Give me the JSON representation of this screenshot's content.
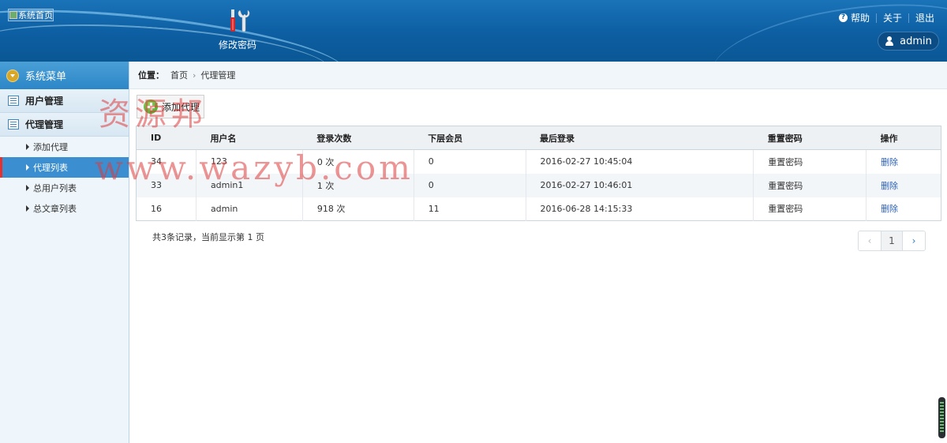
{
  "header": {
    "logo_alt": "系统首页",
    "tool_label": "修改密码",
    "links": {
      "help": "帮助",
      "about": "关于",
      "logout": "退出"
    },
    "user": "admin"
  },
  "sidebar": {
    "title": "系统菜单",
    "groups": [
      {
        "label": "用户管理"
      },
      {
        "label": "代理管理"
      }
    ],
    "items": [
      {
        "label": "添加代理"
      },
      {
        "label": "代理列表"
      },
      {
        "label": "总用户列表"
      },
      {
        "label": "总文章列表"
      }
    ]
  },
  "breadcrumb": {
    "label": "位置：",
    "home": "首页",
    "current": "代理管理"
  },
  "toolbar": {
    "add_label": "添加代理"
  },
  "table": {
    "columns": [
      "ID",
      "用户名",
      "登录次数",
      "下层会员",
      "最后登录",
      "重置密码",
      "操作"
    ],
    "rows": [
      {
        "id": "34",
        "username": "123",
        "logins": "0 次",
        "members": "0",
        "last_login": "2016-02-27 10:45:04",
        "reset": "重置密码",
        "action": "删除"
      },
      {
        "id": "33",
        "username": "admin1",
        "logins": "1 次",
        "members": "0",
        "last_login": "2016-02-27 10:46:01",
        "reset": "重置密码",
        "action": "删除"
      },
      {
        "id": "16",
        "username": "admin",
        "logins": "918 次",
        "members": "11",
        "last_login": "2016-06-28 14:15:33",
        "reset": "重置密码",
        "action": "删除"
      }
    ]
  },
  "footer": {
    "summary": "共3条记录，当前显示第 1 页"
  },
  "pager": {
    "prev": "‹",
    "current": "1",
    "next": "›"
  },
  "watermark": {
    "line1": "资源邦",
    "line2": "www.wazyb.com"
  }
}
